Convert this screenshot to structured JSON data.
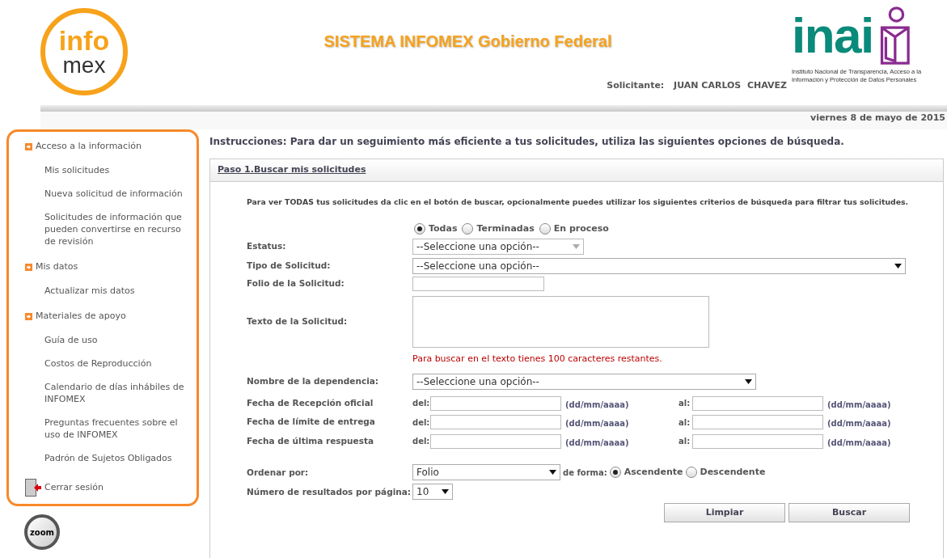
{
  "header": {
    "logo_top": "info",
    "logo_bottom": "mex",
    "title": "SISTEMA INFOMEX Gobierno Federal",
    "applicant_label": "Solicitante:",
    "applicant_name": "JUAN CARLOS  CHAVEZ",
    "inai_logo": "inai",
    "inai_caption": "Instituto Nacional de Transparencia, Acceso a la Información y Protección de Datos Personales",
    "date": "viernes 8 de mayo de 2015"
  },
  "sidebar": {
    "sections": [
      {
        "title": "Acceso a la información",
        "items": [
          "Mis solicitudes",
          "Nueva solicitud de información",
          "Solicitudes de información que pueden convertirse en recurso de revisión"
        ]
      },
      {
        "title": "Mis datos",
        "items": [
          "Actualizar mis datos"
        ]
      },
      {
        "title": "Materiales de apoyo",
        "items": [
          "Guía de uso",
          "Costos de Reproducción",
          "Calendario de días inhábiles de INFOMEX",
          "Preguntas frecuentes sobre el uso de INFOMEX",
          "Padrón de Sujetos Obligados"
        ]
      }
    ],
    "logout": "Cerrar sesión",
    "zoom": "zoom"
  },
  "instructions": "Instrucciones: Para dar un seguimiento más eficiente a tus solicitudes, utiliza las siguientes opciones de búsqueda.",
  "panel": {
    "title": "Paso 1.Buscar mis solicitudes",
    "intro": "Para ver TODAS tus solicitudes da clic en el botón de buscar, opcionalmente puedes utilizar los siguientes criterios de búsqueda para filtrar tus solicitudes.",
    "status_options": [
      {
        "label": "Todas",
        "selected": true
      },
      {
        "label": "Terminadas",
        "selected": false
      },
      {
        "label": "En proceso",
        "selected": false
      }
    ],
    "estatus": {
      "label": "Estatus:",
      "value": "--Seleccione una opción--",
      "disabled": true
    },
    "tipo": {
      "label": "Tipo de Solicitud:",
      "value": "--Seleccione una opción--"
    },
    "folio": {
      "label": "Folio de la Solicitud:"
    },
    "texto": {
      "label": "Texto de la Solicitud:",
      "hint": "Para buscar en el texto tienes 100  caracteres restantes."
    },
    "dependencia": {
      "label": "Nombre de la dependencia:",
      "value": "--Seleccione una opción--"
    },
    "dates": [
      {
        "label": "Fecha de Recepción oficial",
        "from": "del:",
        "from_hint": "(dd/mm/aaaa)",
        "to": "al:",
        "to_hint": "(dd/mm/aaaa)"
      },
      {
        "label": "Fecha de límite de entrega",
        "from": "del:",
        "from_hint": "(dd/mm/aaaa)",
        "to": "al:",
        "to_hint": "(dd/mm/aaaa)"
      },
      {
        "label": "Fecha de última respuesta",
        "from": "del:",
        "from_hint": "(dd/mm/aaaa)",
        "to": "al:",
        "to_hint": "(dd/mm/aaaa)"
      }
    ],
    "order": {
      "label": "Ordenar por:",
      "value": "Folio",
      "direction_label": "de forma:",
      "directions": [
        {
          "label": "Ascendente",
          "selected": true
        },
        {
          "label": "Descendente",
          "selected": false
        }
      ]
    },
    "per_page": {
      "label": "Número de resultados por página:",
      "value": "10"
    },
    "buttons": [
      "Limpiar",
      "Buscar"
    ]
  }
}
